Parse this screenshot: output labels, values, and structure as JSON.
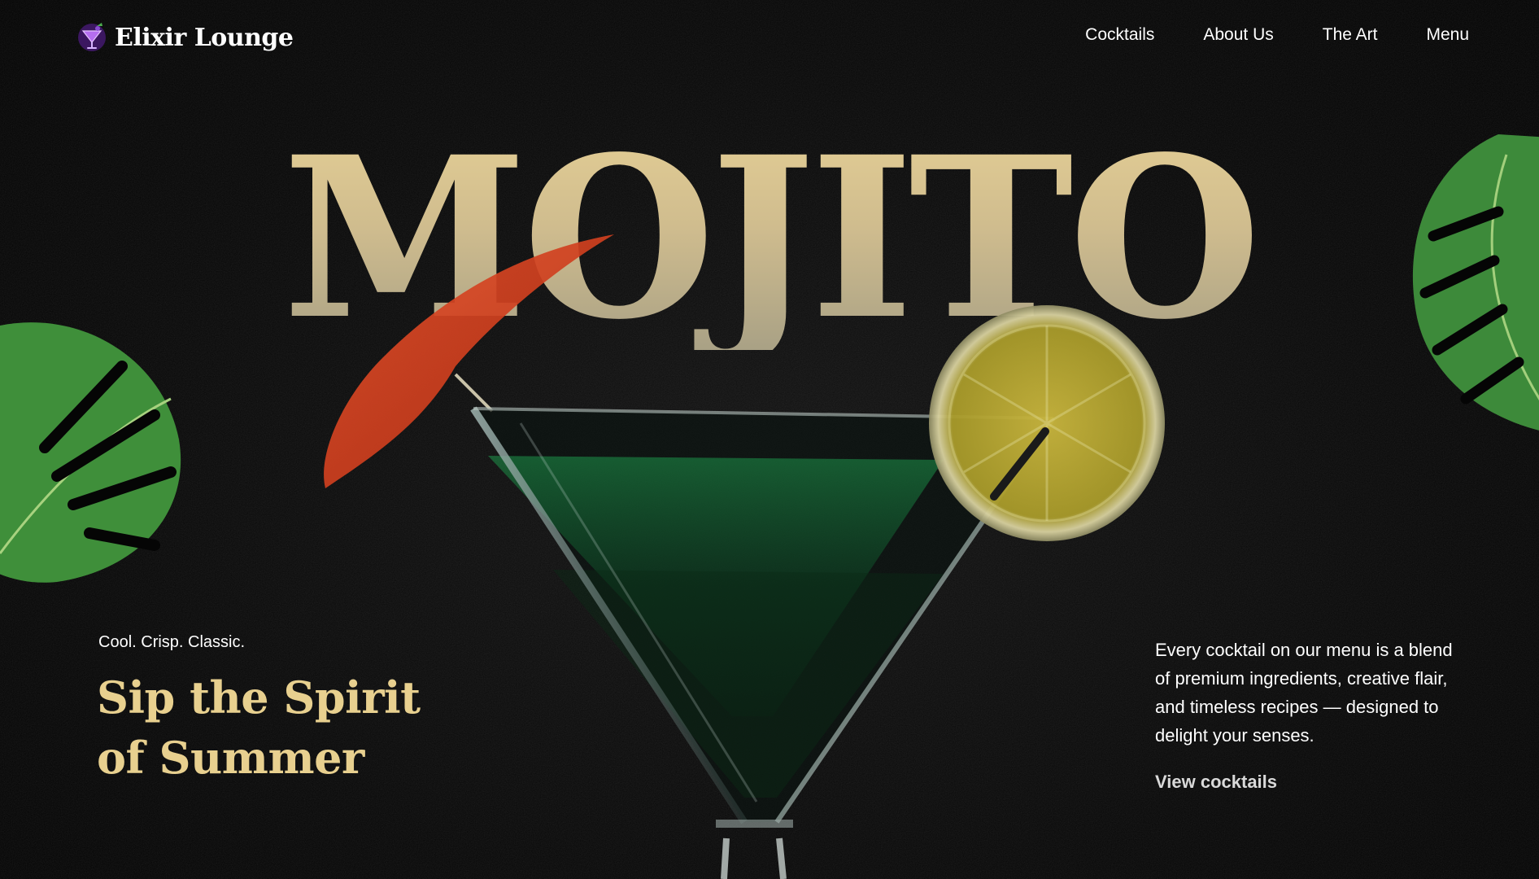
{
  "brand": {
    "name": "Elixir Lounge",
    "logo_icon": "cocktail-glass-icon"
  },
  "nav": {
    "items": [
      {
        "label": "Cocktails"
      },
      {
        "label": "About Us"
      },
      {
        "label": "The Art"
      },
      {
        "label": "Menu"
      }
    ]
  },
  "hero": {
    "title": "MOJITO",
    "tagline": "Cool. Crisp. Classic.",
    "subhead": "Sip the Spirit of Summer",
    "description": "Every cocktail on our menu is a blend of premium ingredients, creative flair, and timeless recipes — designed to delight your senses.",
    "cta_label": "View cocktails"
  },
  "colors": {
    "background": "#050505",
    "title_gold": "#d8c48f",
    "accent_gold": "#e8d08f",
    "text": "#ffffff"
  }
}
